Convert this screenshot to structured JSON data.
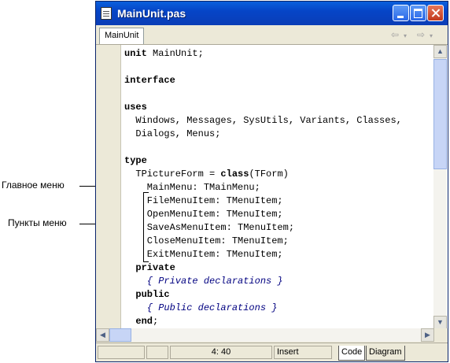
{
  "annotations": {
    "main_menu": "Главное меню",
    "menu_items": "Пункты меню"
  },
  "window": {
    "title": "MainUnit.pas"
  },
  "tabs": [
    {
      "label": "MainUnit"
    }
  ],
  "code": [
    {
      "t": "unit",
      "r": " MainUnit;"
    },
    {
      "t": "",
      "r": ""
    },
    {
      "t": "interface",
      "r": ""
    },
    {
      "t": "",
      "r": ""
    },
    {
      "t": "uses",
      "r": ""
    },
    {
      "t": "",
      "r": "  Windows, Messages, SysUtils, Variants, Classes,"
    },
    {
      "t": "",
      "r": "  Dialogs, Menus;"
    },
    {
      "t": "",
      "r": ""
    },
    {
      "t": "type",
      "r": ""
    },
    {
      "p": "  TPictureForm = ",
      "t": "class",
      "r": "(TForm)"
    },
    {
      "t": "",
      "r": "    MainMenu: TMainMenu;"
    },
    {
      "t": "",
      "r": "    FileMenuItem: TMenuItem;"
    },
    {
      "t": "",
      "r": "    OpenMenuItem: TMenuItem;"
    },
    {
      "t": "",
      "r": "    SaveAsMenuItem: TMenuItem;"
    },
    {
      "t": "",
      "r": "    CloseMenuItem: TMenuItem;"
    },
    {
      "t": "",
      "r": "    ExitMenuItem: TMenuItem;"
    },
    {
      "p": "  ",
      "t": "private",
      "r": ""
    },
    {
      "c": "    { Private declarations }"
    },
    {
      "p": "  ",
      "t": "public",
      "r": ""
    },
    {
      "c": "    { Public declarations }"
    },
    {
      "p": "  ",
      "t": "end",
      "r": ";"
    }
  ],
  "status": {
    "position": "4:  40",
    "mode": "Insert",
    "tab_code": "Code",
    "tab_diagram": "Diagram"
  }
}
